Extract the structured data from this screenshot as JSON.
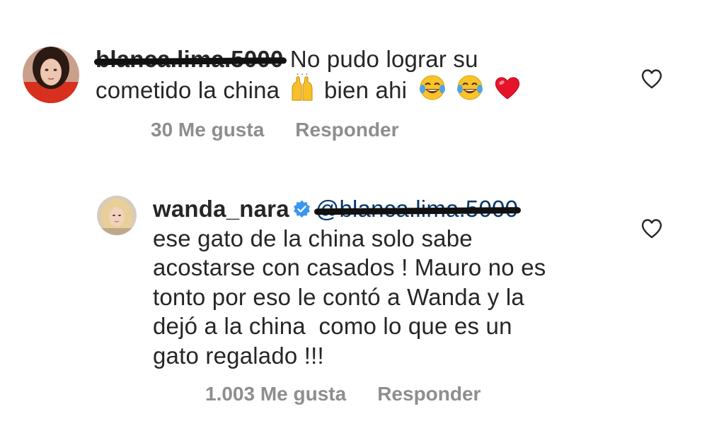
{
  "comments": [
    {
      "username_redacted": "blanca.lima.5000",
      "text_line1": "No pudo lograr su",
      "text_line2_a": "cometido la china",
      "text_line2_b": "bien ahi",
      "emojis": [
        "raising-hands-icon",
        "tears-of-joy-icon",
        "tears-of-joy-icon",
        "red-heart-icon"
      ],
      "likes": "30 Me gusta",
      "reply": "Responder"
    },
    {
      "username": "wanda_nara",
      "verified": true,
      "mention_redacted": "@blanca.lima.5000",
      "lines": [
        "ese gato de la china solo sabe",
        "acostarse con casados ! Mauro no es",
        "tonto por eso le contó a Wanda y la",
        "dejó a la china  como lo que es un",
        "gato regalado !!!"
      ],
      "likes": "1.003 Me gusta",
      "reply": "Responder"
    }
  ],
  "colors": {
    "text": "#262626",
    "meta": "#8e8e8e",
    "verified_blue": "#3897f0",
    "mention": "#00376b"
  }
}
